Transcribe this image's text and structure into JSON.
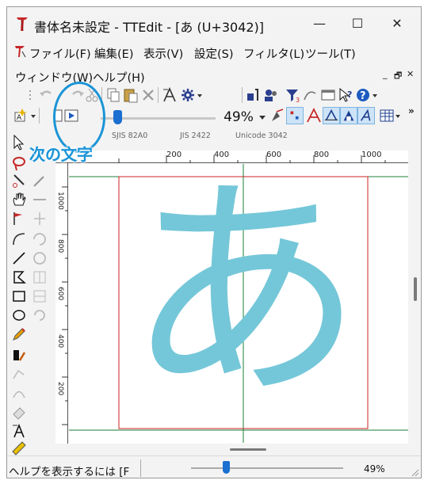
{
  "title": {
    "text": "書体名未設定 - TTEdit - [あ (U+3042)]",
    "minimize": "—",
    "maximize": "☐",
    "close": "✕"
  },
  "menu": {
    "file": "ファイル(F)",
    "edit": "編集(E)",
    "view": "表示(V)",
    "settings": "設定(S)",
    "filter": "フィルタ(L)",
    "tools": "ツール(T)",
    "window": "ウィンドウ(W)",
    "help": "ヘルプ(H)"
  },
  "mdi": {
    "minimize": "_",
    "restore": "🗗",
    "close": "✕"
  },
  "toolbar": {
    "zoom_value": "49%",
    "slider_level": 0.1
  },
  "info": {
    "sjis": "SJIS 82A0",
    "jis": "JIS 2422",
    "unicode": "Unicode 3042"
  },
  "annotation": {
    "text": "次の文字"
  },
  "ruler": {
    "top_labels": [
      "200",
      "400",
      "600",
      "800",
      "1000"
    ],
    "left_labels": [
      "1000",
      "800",
      "600",
      "400",
      "200"
    ]
  },
  "glyph": {
    "char": "あ",
    "color": "#74c7d8"
  },
  "status": {
    "help_text": "ヘルプを表示するには [F",
    "zoom": "49%",
    "slider_level": 0.2
  },
  "colors": {
    "accent": "#1b94d6",
    "guide_red": "#cc2222",
    "guide_green": "#1b7f3a",
    "slider": "#1a6fd0"
  }
}
